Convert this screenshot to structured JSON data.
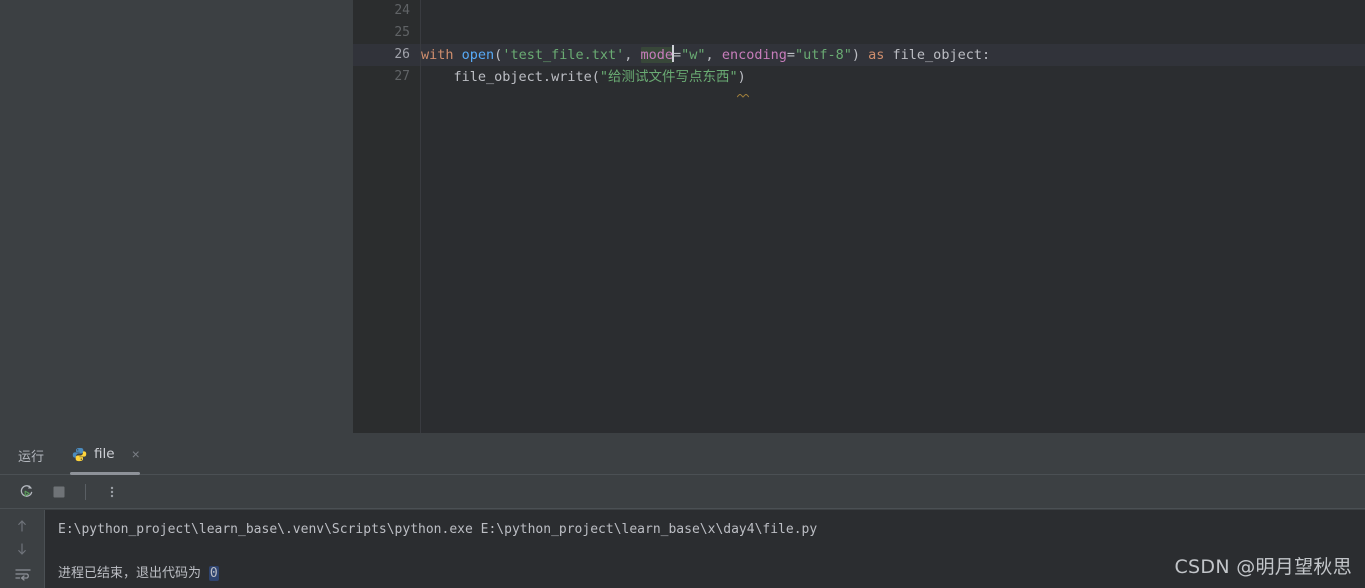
{
  "editor": {
    "lines": [
      {
        "number": "24",
        "kind": "empty",
        "current": false,
        "bulb": false
      },
      {
        "number": "25",
        "kind": "empty",
        "current": false,
        "bulb": true
      },
      {
        "number": "26",
        "kind": "code",
        "current": true,
        "bulb": false,
        "text": "with open('test_file.txt', mode=\"w\", encoding=\"utf-8\") as file_object:"
      },
      {
        "number": "27",
        "kind": "code",
        "current": false,
        "bulb": false,
        "text": "    file_object.write(\"给测试文件写点东西\")"
      }
    ],
    "line26": {
      "kw_with": "with",
      "fn_open": "open",
      "paren_open": "(",
      "str_path": "'test_file.txt'",
      "comma1": ", ",
      "kwarg_mode": "mode",
      "eq1": "=",
      "str_w": "\"w\"",
      "comma2": ", ",
      "kwarg_encoding": "encoding",
      "eq2": "=",
      "str_utf8": "\"utf-8\"",
      "paren_close": ")",
      "kw_as": " as ",
      "ident_fileobject": "file_object",
      "colon": ":"
    },
    "line27": {
      "indent": "    ",
      "ident_fileobject": "file_object",
      "dot": ".",
      "method_write": "write",
      "paren_open": "(",
      "str_cjk": "\"给测试文件写点东西\"",
      "paren_close": ")"
    }
  },
  "run_panel": {
    "title": "运行",
    "tab": {
      "label": "file",
      "icon": "python-icon",
      "close": "×"
    },
    "toolbar": {
      "rerun": "rerun-icon",
      "stop": "stop-icon",
      "more": "more-options-icon"
    },
    "gutter": {
      "up": "scroll-up-icon",
      "down": "scroll-down-icon",
      "wrap": "soft-wrap-icon"
    },
    "console": {
      "command": "E:\\python_project\\learn_base\\.venv\\Scripts\\python.exe E:\\python_project\\learn_base\\x\\day4\\file.py",
      "exit_message_prefix": "进程已结束，退出代码为 ",
      "exit_code": "0"
    }
  },
  "watermark": {
    "text": "CSDN @明月望秋思"
  },
  "colors": {
    "editor_bg": "#2b2d30",
    "gutter_bg": "#2b2d2e",
    "panel_bg": "#3c4043",
    "current_line": "#31333a",
    "keyword": "#cf8e6d",
    "function": "#57aaf7",
    "string": "#6aab73",
    "kwarg": "#c77dbb",
    "text": "#bcbec4",
    "line_number": "#606366",
    "exit_code_hl": "#2e436e"
  }
}
